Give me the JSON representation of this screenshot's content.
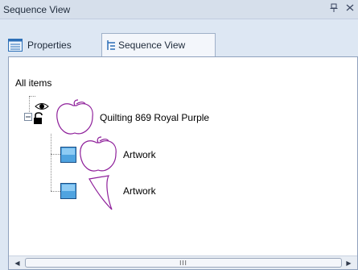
{
  "window": {
    "title": "Sequence View",
    "pin_glyph": "Ͱ",
    "close_glyph": "✕"
  },
  "tabs": [
    {
      "label": "Properties",
      "icon": "properties-icon"
    },
    {
      "label": "Sequence View",
      "icon": "sequence-view-icon",
      "active": true
    }
  ],
  "tree": {
    "root_label": "All items",
    "group": {
      "label": "Quilting 869 Royal Purple",
      "expanded": true,
      "visible": true,
      "locked": true,
      "children": [
        {
          "label": "Artwork",
          "shape": "apple-outline"
        },
        {
          "label": "Artwork",
          "shape": "sliver-outline"
        }
      ]
    }
  },
  "scrollbar": {
    "left_glyph": "◀",
    "right_glyph": "▶",
    "grip": "III"
  },
  "colors": {
    "accent": "#7b1fa2",
    "node_box": "#4fa3e0",
    "pane_bg": "#ffffff",
    "chrome_bg": "#dde7f3"
  }
}
